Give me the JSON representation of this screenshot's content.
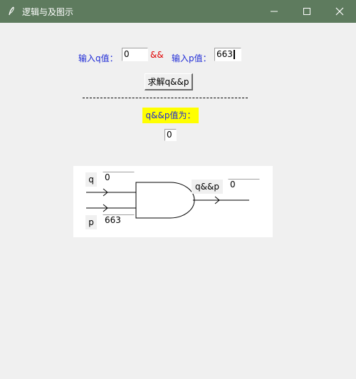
{
  "window": {
    "title": "逻辑与及图示",
    "icon": "feather-icon",
    "controls": [
      "minimize-icon",
      "maximize-icon",
      "close-icon"
    ]
  },
  "inputs": {
    "q_label": "输入q值：",
    "q_value": "0",
    "and_symbol": "&&",
    "p_label": "输入p值：",
    "p_value": "663"
  },
  "solve_button": "求解q&&p",
  "result": {
    "label": "q&&p值为：",
    "value": "0"
  },
  "diagram": {
    "q_label": "q",
    "q_value": "0",
    "p_label": "p",
    "p_value": "663",
    "out_label": "q&&p",
    "out_value": "0"
  },
  "colors": {
    "titlebar": "#5e7b5e",
    "label_blue": "#1f2bd6",
    "and_red": "#e00000",
    "result_bg": "#ffff00"
  }
}
